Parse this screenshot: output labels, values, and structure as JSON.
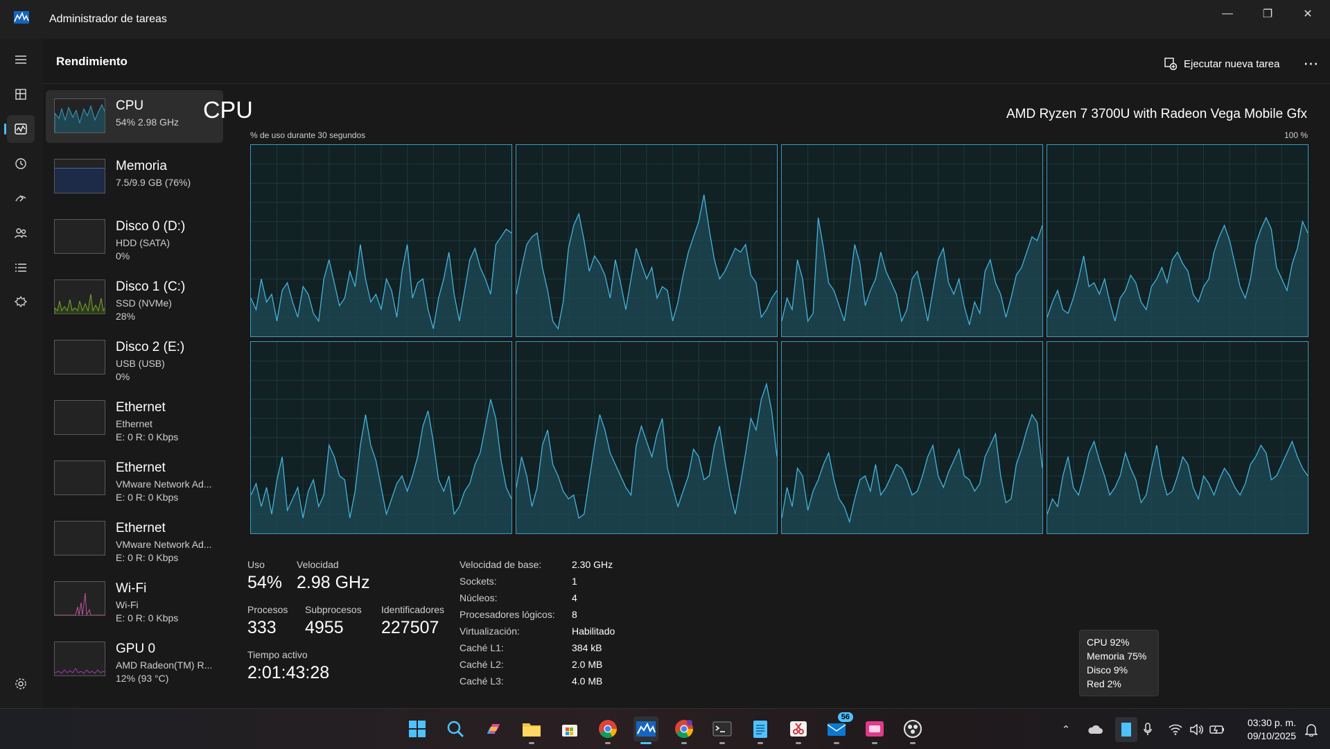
{
  "window": {
    "title": "Administrador de tareas"
  },
  "header": {
    "title": "Rendimiento",
    "run_task_label": "Ejecutar nueva tarea"
  },
  "perf_items": [
    {
      "name": "CPU",
      "sub": "54% 2.98 GHz",
      "color": "#3a9bc0"
    },
    {
      "name": "Memoria",
      "sub": "7.5/9.9 GB (76%)",
      "color": "#3a6fb0"
    },
    {
      "name": "Disco 0 (D:)",
      "sub": "HDD (SATA)",
      "sub2": "0%",
      "color": "#7aa23a"
    },
    {
      "name": "Disco 1 (C:)",
      "sub": "SSD (NVMe)",
      "sub2": "28%",
      "color": "#7aa23a"
    },
    {
      "name": "Disco 2 (E:)",
      "sub": "USB (USB)",
      "sub2": "0%",
      "color": "#7aa23a"
    },
    {
      "name": "Ethernet",
      "sub": "Ethernet",
      "sub2": "E: 0 R: 0 Kbps",
      "color": "#c0549a"
    },
    {
      "name": "Ethernet",
      "sub": "VMware Network Ad...",
      "sub2": "E: 0 R: 0 Kbps",
      "color": "#c0549a"
    },
    {
      "name": "Ethernet",
      "sub": "VMware Network Ad...",
      "sub2": "E: 0 R: 0 Kbps",
      "color": "#c0549a"
    },
    {
      "name": "Wi-Fi",
      "sub": "Wi-Fi",
      "sub2": "E: 0 R: 0 Kbps",
      "color": "#c0549a"
    },
    {
      "name": "GPU 0",
      "sub": "AMD Radeon(TM) R...",
      "sub2": "12% (93 °C)",
      "color": "#a03ab0"
    }
  ],
  "cpu": {
    "title": "CPU",
    "model": "AMD Ryzen 7 3700U with Radeon Vega Mobile Gfx",
    "graph_label": "% de uso durante 30 segundos",
    "graph_max": "100 %",
    "cores": [
      [
        20,
        14,
        30,
        18,
        22,
        8,
        24,
        28,
        18,
        10,
        26,
        22,
        12,
        8,
        30,
        40,
        28,
        16,
        20,
        34,
        26,
        48,
        30,
        18,
        22,
        14,
        30,
        24,
        10,
        34,
        48,
        20,
        28,
        30,
        14,
        4,
        20,
        30,
        44,
        22,
        8,
        24,
        40,
        46,
        36,
        30,
        22,
        48,
        52,
        56,
        54
      ],
      [
        22,
        36,
        48,
        52,
        54,
        36,
        24,
        8,
        4,
        18,
        46,
        58,
        64,
        50,
        34,
        42,
        38,
        32,
        20,
        40,
        28,
        14,
        30,
        46,
        38,
        30,
        36,
        20,
        26,
        24,
        8,
        18,
        32,
        44,
        52,
        60,
        74,
        56,
        40,
        30,
        34,
        40,
        46,
        44,
        48,
        32,
        28,
        10,
        14,
        20,
        24
      ],
      [
        8,
        20,
        14,
        40,
        30,
        8,
        12,
        62,
        46,
        28,
        24,
        16,
        8,
        26,
        48,
        38,
        16,
        24,
        30,
        44,
        34,
        28,
        22,
        8,
        14,
        30,
        34,
        22,
        8,
        24,
        40,
        46,
        28,
        22,
        30,
        16,
        6,
        18,
        12,
        34,
        40,
        28,
        22,
        10,
        20,
        32,
        36,
        44,
        52,
        50,
        58
      ],
      [
        10,
        18,
        24,
        14,
        12,
        20,
        30,
        42,
        26,
        28,
        22,
        30,
        18,
        8,
        20,
        24,
        32,
        28,
        18,
        14,
        26,
        30,
        36,
        28,
        40,
        44,
        38,
        34,
        22,
        18,
        26,
        30,
        44,
        52,
        58,
        50,
        38,
        26,
        20,
        30,
        48,
        56,
        62,
        56,
        36,
        30,
        24,
        38,
        46,
        60,
        54
      ],
      [
        20,
        26,
        14,
        24,
        10,
        28,
        40,
        12,
        18,
        24,
        8,
        22,
        28,
        14,
        20,
        46,
        40,
        30,
        28,
        8,
        22,
        46,
        62,
        46,
        38,
        24,
        10,
        18,
        26,
        30,
        22,
        30,
        40,
        56,
        64,
        48,
        28,
        22,
        30,
        10,
        14,
        22,
        26,
        36,
        42,
        56,
        70,
        60,
        38,
        24,
        18
      ],
      [
        24,
        40,
        30,
        14,
        24,
        46,
        54,
        36,
        30,
        22,
        18,
        20,
        8,
        10,
        28,
        46,
        62,
        54,
        42,
        36,
        30,
        24,
        20,
        46,
        56,
        48,
        40,
        52,
        60,
        34,
        24,
        14,
        22,
        30,
        44,
        40,
        28,
        30,
        46,
        56,
        38,
        22,
        10,
        26,
        42,
        60,
        54,
        70,
        78,
        64,
        40
      ],
      [
        8,
        24,
        14,
        34,
        30,
        12,
        22,
        28,
        36,
        42,
        28,
        18,
        14,
        6,
        18,
        28,
        30,
        22,
        36,
        20,
        24,
        30,
        36,
        34,
        28,
        20,
        22,
        30,
        40,
        46,
        30,
        24,
        32,
        38,
        44,
        30,
        28,
        22,
        26,
        40,
        46,
        52,
        30,
        16,
        18,
        36,
        44,
        54,
        62,
        58,
        34
      ],
      [
        10,
        18,
        14,
        30,
        40,
        24,
        20,
        30,
        42,
        48,
        38,
        30,
        20,
        24,
        30,
        42,
        34,
        28,
        16,
        20,
        34,
        46,
        30,
        20,
        22,
        30,
        40,
        36,
        24,
        18,
        30,
        26,
        20,
        28,
        34,
        30,
        24,
        20,
        26,
        36,
        40,
        46,
        42,
        28,
        30,
        36,
        42,
        48,
        40,
        34,
        30
      ]
    ]
  },
  "stats": {
    "uso_label": "Uso",
    "uso": "54%",
    "velocidad_label": "Velocidad",
    "velocidad": "2.98 GHz",
    "procesos_label": "Procesos",
    "procesos": "333",
    "subprocesos_label": "Subprocesos",
    "subprocesos": "4955",
    "identificadores_label": "Identificadores",
    "identificadores": "227507",
    "tiempo_label": "Tiempo activo",
    "tiempo": "2:01:43:28"
  },
  "specs": [
    {
      "label": "Velocidad de base:",
      "value": "2.30 GHz"
    },
    {
      "label": "Sockets:",
      "value": "1"
    },
    {
      "label": "Núcleos:",
      "value": "4"
    },
    {
      "label": "Procesadores lógicos:",
      "value": "8"
    },
    {
      "label": "Virtualización:",
      "value": "Habilitado"
    },
    {
      "label": "Caché L1:",
      "value": "384 kB"
    },
    {
      "label": "Caché L2:",
      "value": "2.0 MB"
    },
    {
      "label": "Caché L3:",
      "value": "4.0 MB"
    }
  ],
  "tooltip": {
    "cpu": "CPU 92%",
    "memoria": "Memoria 75%",
    "disco": "Disco 9%",
    "red": "Red 2%"
  },
  "taskbar": {
    "time": "03:30 p. m.",
    "date": "09/10/2025",
    "mail_badge": "56"
  }
}
